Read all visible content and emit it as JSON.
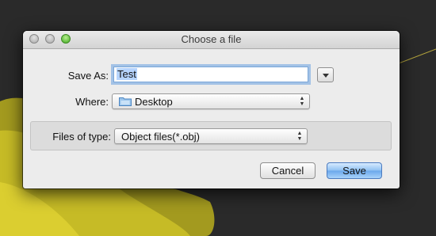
{
  "dialog": {
    "title": "Choose a file",
    "save_as_label": "Save As:",
    "file_name_value": "Test",
    "where_label": "Where:",
    "where_value": "Desktop",
    "where_icon": "folder-icon",
    "file_type_label": "Files of type:",
    "file_type_value": "Object files(*.obj)",
    "cancel_label": "Cancel",
    "save_label": "Save"
  },
  "colors": {
    "accent": "#6aa7eb",
    "focus_ring": "#67a0e2",
    "window_bg": "#ececec",
    "desktop_bg": "#2a2a2a",
    "background_shape": "#a39a1f"
  }
}
